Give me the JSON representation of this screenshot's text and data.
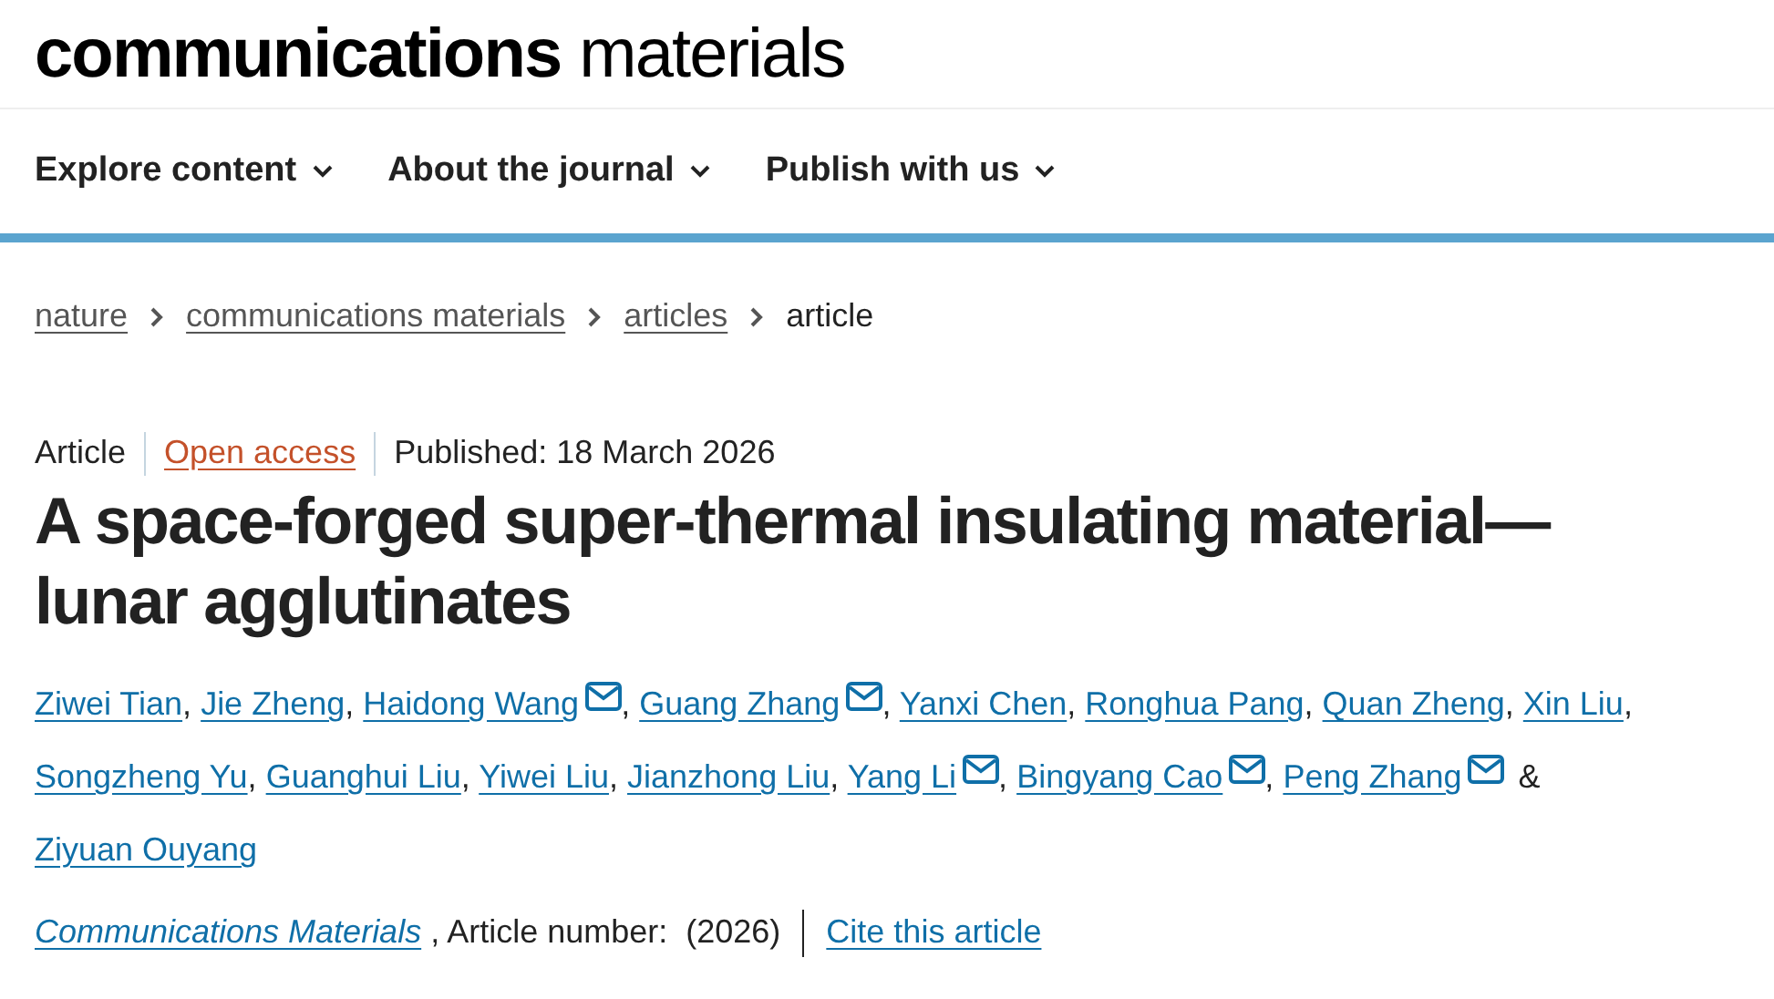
{
  "logo": {
    "bold_part": "communications",
    "light_part": "materials"
  },
  "nav": [
    {
      "label": "Explore content"
    },
    {
      "label": "About the journal"
    },
    {
      "label": "Publish with us"
    }
  ],
  "breadcrumb": [
    {
      "label": "nature",
      "kind": "link"
    },
    {
      "label": "communications materials",
      "kind": "link"
    },
    {
      "label": "articles",
      "kind": "link"
    },
    {
      "label": "article",
      "kind": "current"
    }
  ],
  "meta": [
    {
      "text": "Article",
      "kind": "type"
    },
    {
      "text": "Open access",
      "kind": "access"
    },
    {
      "text": "Published: 18 March 2026",
      "kind": "date"
    }
  ],
  "title": "A space-forged super-thermal insulating material—lunar agglutinates",
  "authors": [
    {
      "name": "Ziwei Tian",
      "corresponding": false,
      "separator": ","
    },
    {
      "name": "Jie Zheng",
      "corresponding": false,
      "separator": ","
    },
    {
      "name": "Haidong Wang",
      "corresponding": true,
      "separator": ","
    },
    {
      "name": "Guang Zhang",
      "corresponding": true,
      "separator": ","
    },
    {
      "name": "Yanxi Chen",
      "corresponding": false,
      "separator": ","
    },
    {
      "name": "Ronghua Pang",
      "corresponding": false,
      "separator": ","
    },
    {
      "name": "Quan Zheng",
      "corresponding": false,
      "separator": ","
    },
    {
      "name": "Xin Liu",
      "corresponding": false,
      "separator": ","
    },
    {
      "name": "Songzheng Yu",
      "corresponding": false,
      "separator": ","
    },
    {
      "name": "Guanghui Liu",
      "corresponding": false,
      "separator": ","
    },
    {
      "name": "Yiwei Liu",
      "corresponding": false,
      "separator": ","
    },
    {
      "name": "Jianzhong Liu",
      "corresponding": false,
      "separator": ","
    },
    {
      "name": "Yang Li",
      "corresponding": true,
      "separator": ","
    },
    {
      "name": "Bingyang Cao",
      "corresponding": true,
      "separator": ","
    },
    {
      "name": "Peng Zhang",
      "corresponding": true,
      "separator": "&"
    },
    {
      "name": "Ziyuan Ouyang",
      "corresponding": false
    }
  ],
  "citation": {
    "journal": "Communications Materials",
    "details": ", Article number:  (2026)",
    "cite_link": "Cite this article"
  }
}
